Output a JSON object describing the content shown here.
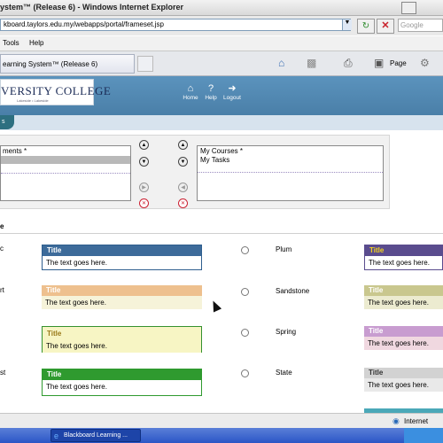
{
  "window": {
    "title": "ystem™ (Release 6) - Windows Internet Explorer"
  },
  "address": {
    "url": "kboard.taylors.edu.my/webapps/portal/frameset.jsp",
    "search_placeholder": "Google"
  },
  "menu": {
    "tools": "Tools",
    "help": "Help"
  },
  "tab": {
    "label": "earning System™ (Release 6)"
  },
  "toolbar": {
    "page": "Page"
  },
  "header": {
    "logo_text": "VERSITY COLLEGE",
    "logo_subtext": "Lakeside • Lakeside",
    "nav": [
      {
        "label": "Home",
        "icon": "home-icon"
      },
      {
        "label": "Help",
        "icon": "help-icon"
      },
      {
        "label": "Logout",
        "icon": "logout-icon"
      }
    ]
  },
  "tabs_strip": {
    "label": "s"
  },
  "modules": {
    "left_list": [
      "ments *"
    ],
    "right_list": [
      "My Courses *",
      "My Tasks"
    ]
  },
  "section": {
    "title": "e"
  },
  "color_schemes": {
    "left": [
      {
        "name": "c",
        "title": "Title",
        "body": "The text goes here.",
        "title_bg": "#3d6b9a",
        "title_color": "#ffffff",
        "body_bg": "#ffffff",
        "border": "#2f5f8f"
      },
      {
        "name": "rt",
        "title": "Title",
        "body": "The text goes here.",
        "title_bg": "#eec08e",
        "title_color": "#ffffff",
        "body_bg": "#f6f3d9",
        "border": "#f6f3d9"
      },
      {
        "name": "",
        "title": "Title",
        "body": "The text goes here.",
        "title_bg": "#f7f5c4",
        "title_color": "#9a7a1a",
        "body_bg": "#f7f5c4",
        "border": "#35912f"
      },
      {
        "name": "st",
        "title": "Title",
        "body": "The text goes here.",
        "title_bg": "#2f9a2f",
        "title_color": "#ffffff",
        "body_bg": "#ffffff",
        "border": "#2f9a2f"
      }
    ],
    "right": [
      {
        "name": "Plum",
        "title": "Title",
        "body": "The text goes here.",
        "title_bg": "#5a4c8e",
        "title_color": "#f2d21e",
        "body_bg": "#ffffff",
        "border": "#5a4c8e"
      },
      {
        "name": "Sandstone",
        "title": "Title",
        "body": "The text goes here.",
        "title_bg": "#c9c78e",
        "title_color": "#ffffff",
        "body_bg": "#ecebd0",
        "border": "#ecebd0"
      },
      {
        "name": "Spring",
        "title": "Title",
        "body": "The text goes here.",
        "title_bg": "#c89cd0",
        "title_color": "#ffffff",
        "body_bg": "#f0d8e0",
        "border": "#f0d8e0"
      },
      {
        "name": "State",
        "title": "Title",
        "body": "The text goes here.",
        "title_bg": "#d2d2d2",
        "title_color": "#333333",
        "body_bg": "#e9e9e9",
        "border": "#e9e9e9"
      }
    ]
  },
  "status": {
    "zone": "Internet"
  },
  "taskbar": {
    "task_label": "Blackboard Learning ..."
  }
}
